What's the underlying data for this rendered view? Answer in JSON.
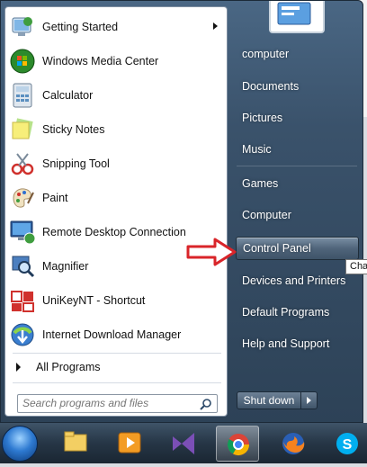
{
  "programs": [
    {
      "label": "Getting Started",
      "icon": "getting-started-icon",
      "submenu": true
    },
    {
      "label": "Windows Media Center",
      "icon": "windows-media-center-icon"
    },
    {
      "label": "Calculator",
      "icon": "calculator-icon"
    },
    {
      "label": "Sticky Notes",
      "icon": "sticky-notes-icon"
    },
    {
      "label": "Snipping Tool",
      "icon": "snipping-tool-icon"
    },
    {
      "label": "Paint",
      "icon": "paint-icon"
    },
    {
      "label": "Remote Desktop Connection",
      "icon": "remote-desktop-icon"
    },
    {
      "label": "Magnifier",
      "icon": "magnifier-icon"
    },
    {
      "label": "UniKeyNT - Shortcut",
      "icon": "unikey-icon"
    },
    {
      "label": "Internet Download Manager",
      "icon": "idm-icon"
    }
  ],
  "all_programs": "All Programs",
  "search": {
    "placeholder": "Search programs and files"
  },
  "right_items": [
    "computer",
    "Documents",
    "Pictures",
    "Music",
    "Games",
    "Computer",
    "Control Panel",
    "Devices and Printers",
    "Default Programs",
    "Help and Support"
  ],
  "highlighted": "Control Panel",
  "shutdown_label": "Shut down",
  "tooltip": "Cha",
  "taskbar": [
    "start-orb",
    "file-explorer-icon",
    "media-player-icon",
    "visual-studio-icon",
    "chrome-icon",
    "firefox-icon",
    "skype-icon"
  ],
  "colors": {
    "accent": "#2d4257",
    "arrow": "#d9252a"
  }
}
